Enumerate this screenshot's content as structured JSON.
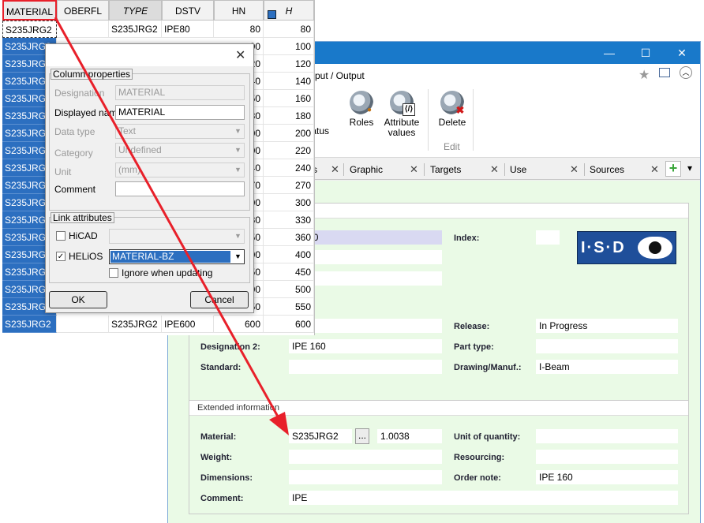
{
  "grid": {
    "headers": [
      "MATERIAL",
      "OBERFL",
      "TYPE",
      "DSTV",
      "HN",
      "H"
    ],
    "first_row": {
      "material": "S235JRG2",
      "type": "S235JRG2",
      "dstv": "IPE80",
      "hn": "80",
      "h": "80"
    },
    "rows_material": [
      "S235JRG2",
      "S235JRG2",
      "S235JRG2",
      "S235JRG2",
      "S235JRG2",
      "S235JRG2",
      "S235JRG2",
      "S235JRG2",
      "S235JRG2",
      "S235JRG2",
      "S235JRG2",
      "S235JRG2",
      "S235JRG2",
      "S235JRG2",
      "S235JRG2",
      "S235JRG2",
      "S235JRG2"
    ],
    "hn_partial": [
      "00",
      "20",
      "40",
      "50",
      "80",
      "00",
      "00",
      "40",
      "70",
      "00",
      "30",
      "50",
      "00",
      "50",
      "00",
      "50"
    ],
    "h_values": [
      "100",
      "120",
      "140",
      "160",
      "180",
      "200",
      "220",
      "240",
      "270",
      "300",
      "330",
      "360",
      "400",
      "450",
      "500",
      "550"
    ],
    "last_row": {
      "material": "S235JRG2",
      "type": "S235JRG2",
      "dstv": "IPE600",
      "hn": "600",
      "h": "600"
    }
  },
  "dialog": {
    "close": "✕",
    "group1": {
      "title": "Column properties",
      "designation_label": "Designation",
      "designation_value": "MATERIAL",
      "displayed_label": "Displayed name",
      "displayed_value": "MATERIAL",
      "datatype_label": "Data type",
      "datatype_value": "Text",
      "category_label": "Category",
      "category_value": "Undefined",
      "unit_label": "Unit",
      "unit_value": "(mm)",
      "comment_label": "Comment",
      "comment_value": ""
    },
    "group2": {
      "title": "Link attributes",
      "hicad_label": "HiCAD",
      "hicad_value": "",
      "helios_label": "HELiOS",
      "helios_value": "MATERIAL-BZ",
      "ignore_label": "Ignore when updating"
    },
    "ok": "OK",
    "cancel": "Cancel"
  },
  "window": {
    "controls": {
      "minimize": "—",
      "maximize": "☐",
      "close": "✕"
    },
    "menu_text": "put / Output",
    "ribbon": {
      "status": "status",
      "roles": "Roles",
      "attr1": "Attribute",
      "attr2": "values",
      "delete": "Delete",
      "edit_group": "Edit"
    },
    "tabs": [
      "s",
      "Graphic",
      "Targets",
      "Use",
      "Sources"
    ],
    "tab_close": "✕",
    "tab_add": "+",
    "tab_menu": "▾",
    "logo_text": "I·S·D",
    "fields": {
      "number_partial": "26130",
      "index_label": "Index:",
      "index_value": "",
      "row0_partial": "0",
      "release_label": "Release:",
      "release_value": "In Progress",
      "designation2_label": "Designation 2:",
      "designation2_value": "IPE 160",
      "parttype_label": "Part type:",
      "parttype_value": "",
      "standard_label": "Standard:",
      "standard_value": "",
      "drawing_label": "Drawing/Manuf.:",
      "drawing_value": "I-Beam"
    },
    "extended": {
      "title": "Extended information",
      "material_label": "Material:",
      "material_value": "S235JRG2",
      "material_btn": "...",
      "material_no": "1.0038",
      "unitqty_label": "Unit of quantity:",
      "unitqty_value": "",
      "weight_label": "Weight:",
      "weight_value": "",
      "resourcing_label": "Resourcing:",
      "resourcing_value": "",
      "dimensions_label": "Dimensions:",
      "dimensions_value": "",
      "ordernote_label": "Order note:",
      "ordernote_value": "IPE 160",
      "comment_label": "Comment:",
      "comment_value": "IPE"
    }
  },
  "colors": {
    "selection": "#2c6fc0",
    "highlight": "#e8202a",
    "titlebar": "#1979ca",
    "panel": "#eafae6"
  }
}
